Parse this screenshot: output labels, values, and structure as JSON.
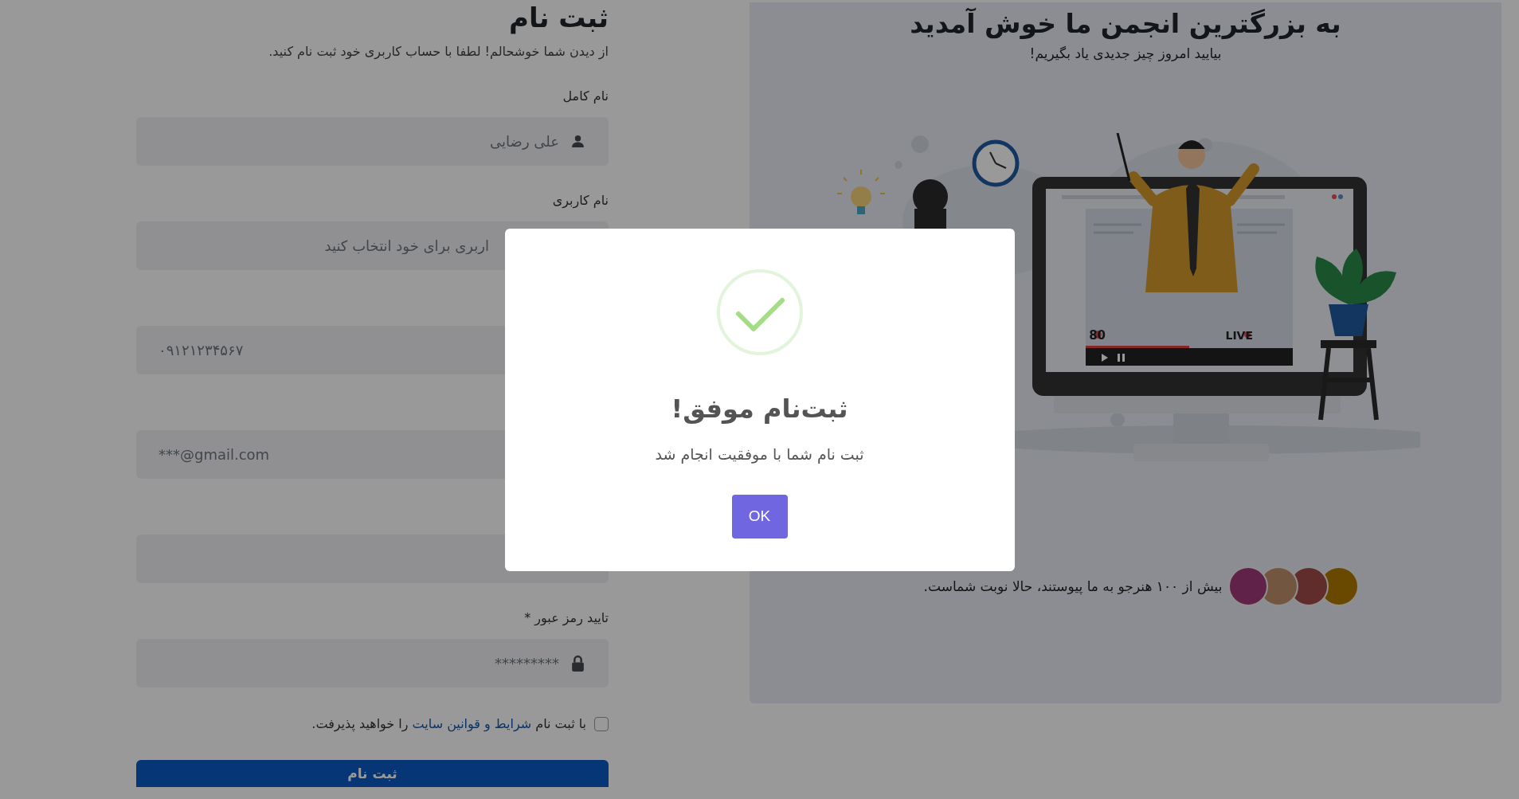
{
  "form": {
    "title": "ثبت نام",
    "subtitle": "از دیدن شما خوشحالم! لطفا با حساب کاربری خود ثبت نام کنید.",
    "fields": [
      {
        "kind": "name",
        "label": "نام کامل",
        "placeholder": "علی رضایی"
      },
      {
        "kind": "username",
        "label": "نام کاربری",
        "placeholder": "اربری برای خود انتخاب کنید"
      },
      {
        "kind": "phone",
        "placeholder": "۰۹۱۲۱۲۳۴۵۶۷"
      },
      {
        "kind": "email",
        "placeholder": "***@gmail.com"
      },
      {
        "kind": "password"
      },
      {
        "kind": "password_confirm",
        "label": "تایید رمز عبور *",
        "placeholder": "*********"
      }
    ],
    "terms": {
      "checked": false,
      "before": "با ثبت نام",
      "link": "شرایط و قوانین سایت",
      "after": "را خواهید پذیرفت."
    },
    "submit": "ثبت نام"
  },
  "hero": {
    "title": "به بزرگترین انجمن ما خوش آمدید",
    "subtitle": "بیایید امروز چیز جدیدی یاد بگیریم!",
    "viewers": "80",
    "live": "LIVE",
    "members_text": "بیش از ۱۰۰ هنرجو به ما پیوستند، حالا نوبت شماست."
  },
  "dialog": {
    "title": "ثبت‌نام موفق!",
    "message": "ثبت نام شما با موفقیت انجام شد",
    "button": "OK"
  }
}
